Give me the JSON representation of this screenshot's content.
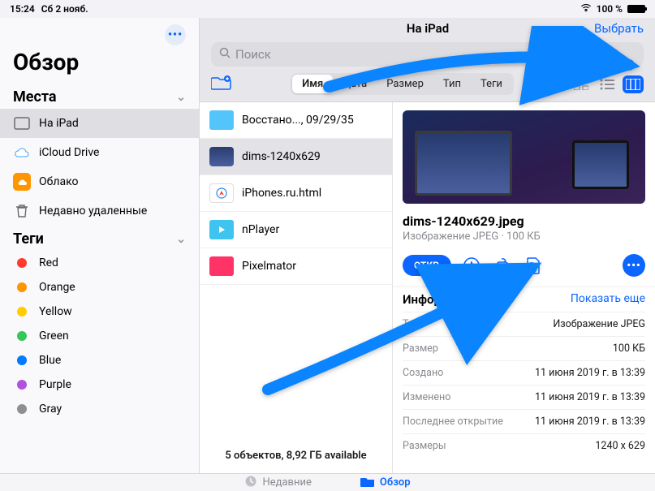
{
  "statusbar": {
    "time": "15:24",
    "date": "Сб 2 нояб.",
    "battery": "100 %"
  },
  "sidebar": {
    "title": "Обзор",
    "sections": {
      "places": {
        "label": "Места",
        "items": [
          {
            "label": "На iPad"
          },
          {
            "label": "iCloud Drive"
          },
          {
            "label": "Облако"
          },
          {
            "label": "Недавно удаленные"
          }
        ]
      },
      "tags": {
        "label": "Теги",
        "items": [
          {
            "label": "Red",
            "color": "#ff3b30"
          },
          {
            "label": "Orange",
            "color": "#ff9500"
          },
          {
            "label": "Yellow",
            "color": "#ffcc00"
          },
          {
            "label": "Green",
            "color": "#34c759"
          },
          {
            "label": "Blue",
            "color": "#007aff"
          },
          {
            "label": "Purple",
            "color": "#af52de"
          },
          {
            "label": "Gray",
            "color": "#8e8e93"
          }
        ]
      }
    }
  },
  "main": {
    "title": "На iPad",
    "select": "Выбрать",
    "search_placeholder": "Поиск",
    "sort": [
      "Имя",
      "Дата",
      "Размер",
      "Тип",
      "Теги"
    ],
    "sort_active": 0
  },
  "files": {
    "items": [
      {
        "label": "Восстано..., 09/29/35"
      },
      {
        "label": "dims-1240x629"
      },
      {
        "label": "iPhones.ru.html"
      },
      {
        "label": "nPlayer"
      },
      {
        "label": "Pixelmator"
      }
    ],
    "status": "5 объектов, 8,92 ГБ available"
  },
  "detail": {
    "name": "dims-1240x629.jpeg",
    "desc": "Изображение JPEG · 100 КБ",
    "open": "ОТКР.",
    "info_label": "Информация",
    "show_more": "Показать еще",
    "rows": [
      {
        "k": "Тип",
        "v": "Изображение JPEG"
      },
      {
        "k": "Размер",
        "v": "100 КБ"
      },
      {
        "k": "Создано",
        "v": "11 июня 2019 г. в 13:39"
      },
      {
        "k": "Изменено",
        "v": "11 июня 2019 г. в 13:39"
      },
      {
        "k": "Последнее открытие",
        "v": "11 июня 2019 г. в 13:39"
      },
      {
        "k": "Размеры",
        "v": "1240 x 629"
      }
    ]
  },
  "bottombar": {
    "recents": "Недавние",
    "browse": "Обзор"
  }
}
